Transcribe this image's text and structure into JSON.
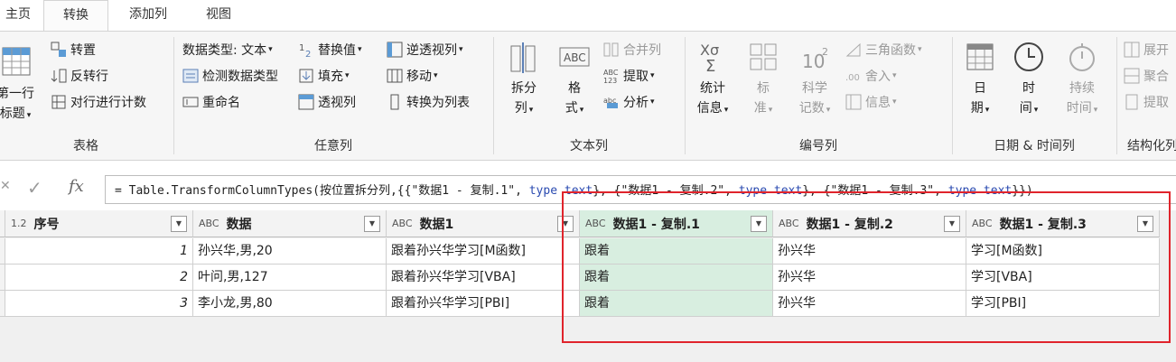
{
  "tabs": [
    "主页",
    "转换",
    "添加列",
    "视图"
  ],
  "groups": {
    "table": {
      "label": "表格",
      "first_row_line1": "第一行",
      "first_row_line2": "作为标题",
      "first_row_visible": "标题",
      "transpose": "转置",
      "reverse_rows": "反转行",
      "count_rows": "对行进行计数"
    },
    "any_column": {
      "label": "任意列",
      "data_type": "数据类型: 文本",
      "detect_type": "检测数据类型",
      "rename": "重命名",
      "replace_values": "替换值",
      "fill": "填充",
      "pivot": "透视列",
      "unpivot": "逆透视列",
      "move": "移动",
      "to_list": "转换为列表"
    },
    "text_column": {
      "label": "文本列",
      "split_line1": "拆分",
      "split_line2": "列",
      "format_line1": "格",
      "format_line2": "式",
      "merge": "合并列",
      "extract": "提取",
      "parse": "分析"
    },
    "number_column": {
      "label": "编号列",
      "stats_line1": "统计",
      "stats_line2": "信息",
      "standard_line1": "标",
      "standard_line2": "准",
      "scientific_line1": "科学",
      "scientific_line2": "记数",
      "trig": "三角函数",
      "rounding": "舍入",
      "info": "信息"
    },
    "datetime": {
      "label": "日期 & 时间列",
      "date_line1": "日",
      "date_line2": "期",
      "time_line1": "时",
      "time_line2": "间",
      "duration_line1": "持续",
      "duration_line2": "时间"
    },
    "structured": {
      "label": "结构化列",
      "expand": "展开",
      "aggregate": "聚合",
      "extract": "提取"
    }
  },
  "formula": {
    "cancel_icon": "close-icon",
    "commit_icon": "check-icon",
    "fx": "fx",
    "prefix": "= Table.TransformColumnTypes(按位置拆分列,{{\"数据1 - 复制.1\", ",
    "kw1": "type text",
    "mid1": "}, {\"数据1 - 复制.2\", ",
    "kw2": "type text",
    "mid2": "}, {\"数据1 - 复制.3\", ",
    "kw3": "type text",
    "suffix": "}})"
  },
  "columns": [
    {
      "type": "1.2",
      "name": "序号"
    },
    {
      "type": "ABC",
      "name": "数据"
    },
    {
      "type": "ABC",
      "name": "数据1"
    },
    {
      "type": "ABC",
      "name": "数据1 - 复制.1"
    },
    {
      "type": "ABC",
      "name": "数据1 - 复制.2"
    },
    {
      "type": "ABC",
      "name": "数据1 - 复制.3"
    }
  ],
  "rows": [
    [
      "1",
      "孙兴华,男,20",
      "跟着孙兴华学习[M函数]",
      "跟着",
      "孙兴华",
      "学习[M函数]"
    ],
    [
      "2",
      "叶问,男,127",
      "跟着孙兴华学习[VBA]",
      "跟着",
      "孙兴华",
      "学习[VBA]"
    ],
    [
      "3",
      "李小龙,男,80",
      "跟着孙兴华学习[PBI]",
      "跟着",
      "孙兴华",
      "学习[PBI]"
    ]
  ],
  "colors": {
    "selected_column": "#d8eee0",
    "highlight_box": "#e0242c"
  }
}
